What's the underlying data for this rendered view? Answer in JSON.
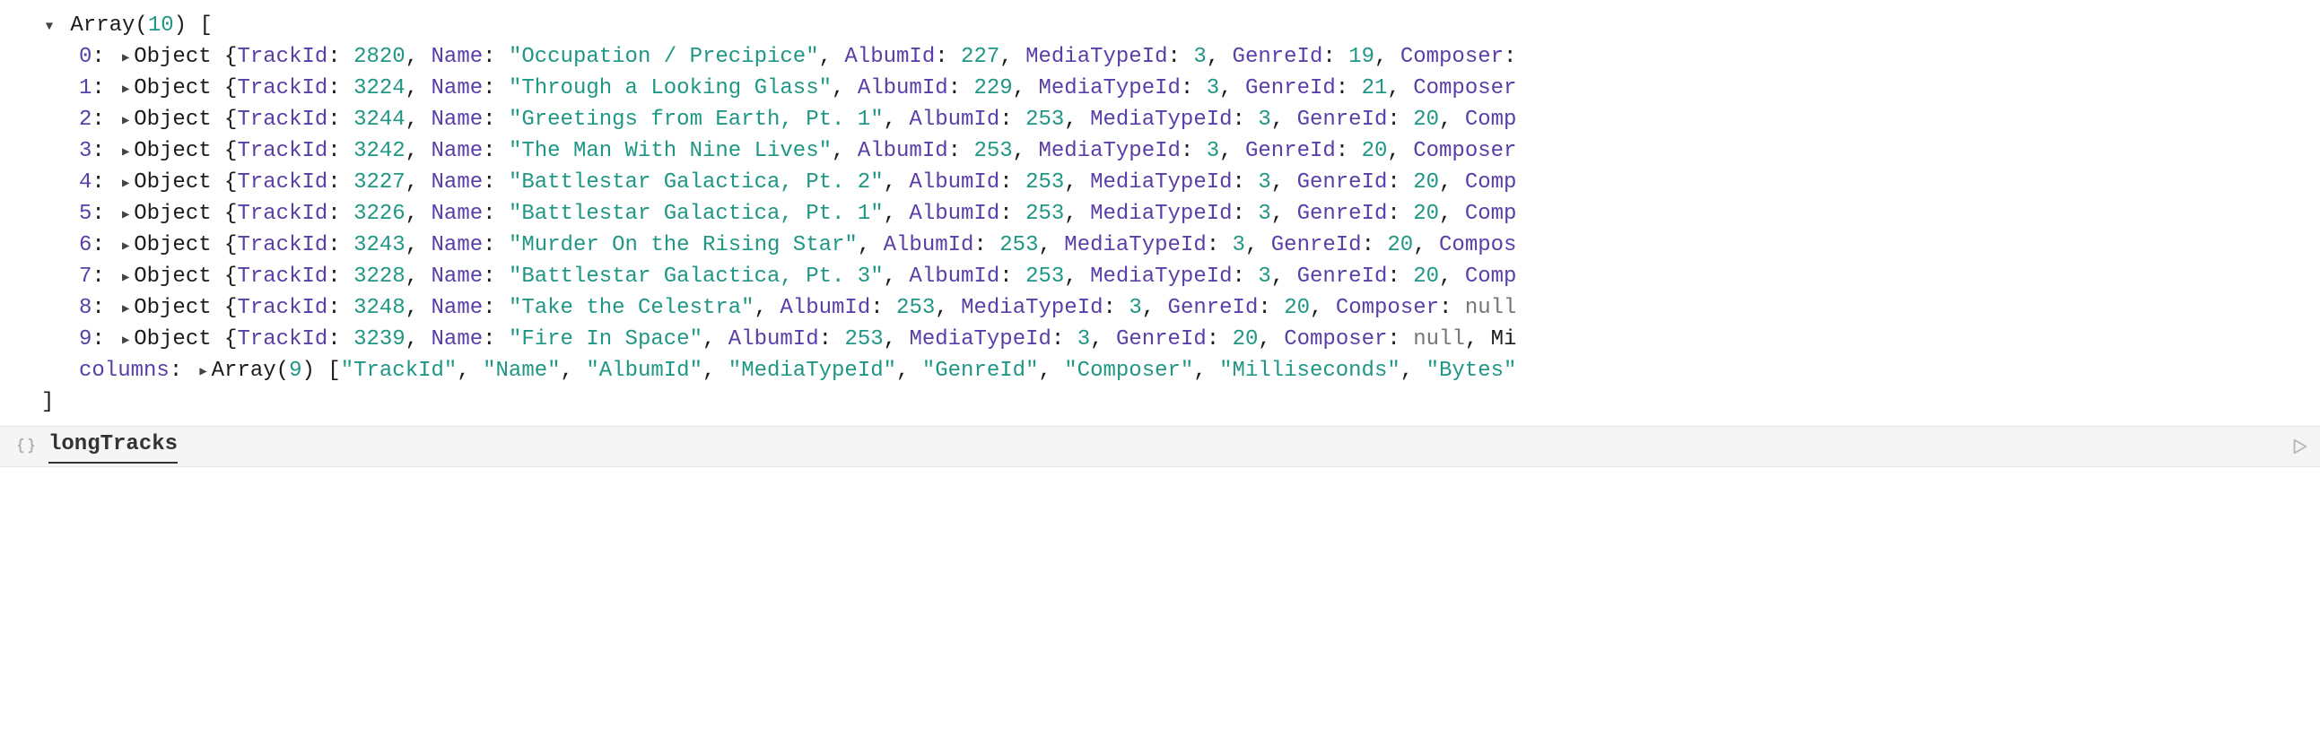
{
  "array_label": "Array",
  "array_len": 10,
  "object_label": "Object",
  "columns_key": "columns",
  "columns_len": 9,
  "columns": [
    "TrackId",
    "Name",
    "AlbumId",
    "MediaTypeId",
    "GenreId",
    "Composer",
    "Milliseconds",
    "Bytes"
  ],
  "input_cell_text": "longTracks",
  "rows": [
    {
      "idx": "0",
      "TrackId": 2820,
      "Name": "Occupation / Precipice",
      "AlbumId": 227,
      "MediaTypeId": 3,
      "GenreId": 19,
      "tail": ", Composer:"
    },
    {
      "idx": "1",
      "TrackId": 3224,
      "Name": "Through a Looking Glass",
      "AlbumId": 229,
      "MediaTypeId": 3,
      "GenreId": 21,
      "tail": ", Composer"
    },
    {
      "idx": "2",
      "TrackId": 3244,
      "Name": "Greetings from Earth, Pt. 1",
      "AlbumId": 253,
      "MediaTypeId": 3,
      "GenreId": 20,
      "tail": ", Comp"
    },
    {
      "idx": "3",
      "TrackId": 3242,
      "Name": "The Man With Nine Lives",
      "AlbumId": 253,
      "MediaTypeId": 3,
      "GenreId": 20,
      "tail": ", Composer"
    },
    {
      "idx": "4",
      "TrackId": 3227,
      "Name": "Battlestar Galactica, Pt. 2",
      "AlbumId": 253,
      "MediaTypeId": 3,
      "GenreId": 20,
      "tail": ", Comp"
    },
    {
      "idx": "5",
      "TrackId": 3226,
      "Name": "Battlestar Galactica, Pt. 1",
      "AlbumId": 253,
      "MediaTypeId": 3,
      "GenreId": 20,
      "tail": ", Comp"
    },
    {
      "idx": "6",
      "TrackId": 3243,
      "Name": "Murder On the Rising Star",
      "AlbumId": 253,
      "MediaTypeId": 3,
      "GenreId": 20,
      "tail": ", Compos"
    },
    {
      "idx": "7",
      "TrackId": 3228,
      "Name": "Battlestar Galactica, Pt. 3",
      "AlbumId": 253,
      "MediaTypeId": 3,
      "GenreId": 20,
      "tail": ", Comp"
    },
    {
      "idx": "8",
      "TrackId": 3248,
      "Name": "Take the Celestra",
      "AlbumId": 253,
      "MediaTypeId": 3,
      "GenreId": 20,
      "tail": ", Composer: ",
      "composer_null": true
    },
    {
      "idx": "9",
      "TrackId": 3239,
      "Name": "Fire In Space",
      "AlbumId": 253,
      "MediaTypeId": 3,
      "GenreId": 20,
      "tail": ", Composer: ",
      "composer_null": true,
      "extra_tail": ", Mi"
    }
  ],
  "k": {
    "TrackId": "TrackId",
    "Name": "Name",
    "AlbumId": "AlbumId",
    "MediaTypeId": "MediaTypeId",
    "GenreId": "GenreId",
    "null": "null"
  }
}
